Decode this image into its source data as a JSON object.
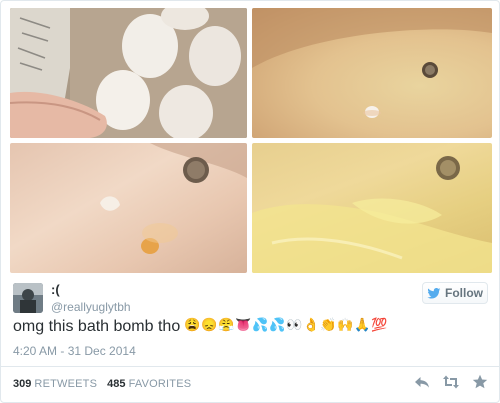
{
  "tweet": {
    "display_name": ":(",
    "screen_name": "@reallyuglytbh",
    "text": "omg this bath bomb tho",
    "emojis": [
      {
        "icon": "weary-face-emoji",
        "glyph": "😩"
      },
      {
        "icon": "disappointed-face-emoji",
        "glyph": "😞"
      },
      {
        "icon": "persevering-face-emoji",
        "glyph": "😤"
      },
      {
        "icon": "tongue-emoji",
        "glyph": "👅"
      },
      {
        "icon": "sweat-droplets-emoji",
        "glyph": "💦"
      },
      {
        "icon": "sweat-droplets-emoji",
        "glyph": "💦"
      },
      {
        "icon": "eyes-emoji",
        "glyph": "👀"
      },
      {
        "icon": "ok-hand-emoji",
        "glyph": "👌"
      },
      {
        "icon": "clapping-hands-emoji",
        "glyph": "👏"
      },
      {
        "icon": "raising-hands-emoji",
        "glyph": "🙌"
      },
      {
        "icon": "folded-hands-emoji",
        "glyph": "🙏"
      },
      {
        "icon": "hundred-points-emoji",
        "glyph": "💯"
      }
    ],
    "timestamp": "4:20 AM - 31 Dec 2014"
  },
  "follow_button": {
    "label": "Follow"
  },
  "stats": {
    "retweets_count": "309",
    "retweets_label": "RETWEETS",
    "favorites_count": "485",
    "favorites_label": "FAVORITES"
  },
  "actions": [
    "reply-icon",
    "retweet-icon",
    "favorite-icon"
  ],
  "colors": {
    "text": "#292f33",
    "muted": "#8899a6",
    "border": "#e1e8ed",
    "twitter_blue": "#55acee"
  }
}
